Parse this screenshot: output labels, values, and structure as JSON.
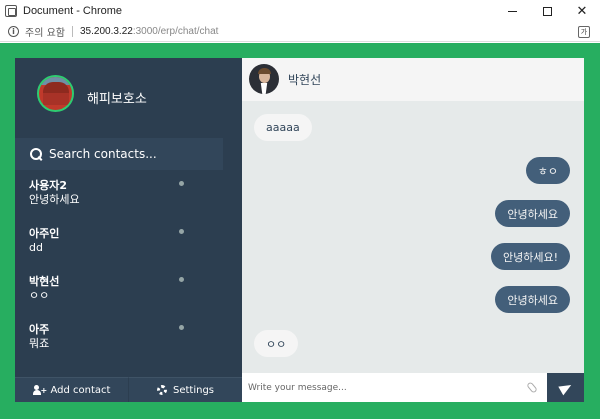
{
  "window": {
    "title": "Document - Chrome"
  },
  "address_bar": {
    "security_label": "주의 요함",
    "url_host": "35.200.3.22",
    "url_path": ":3000/erp/chat/chat"
  },
  "sidebar": {
    "profile_name": "해피보호소",
    "search": {
      "placeholder": "Search contacts..."
    },
    "contacts": [
      {
        "name": "사용자2",
        "preview": "안녕하세요"
      },
      {
        "name": "아주인",
        "preview": "dd"
      },
      {
        "name": "박현선",
        "preview": "ㅇㅇ"
      },
      {
        "name": "아주",
        "preview": "뭐죠"
      }
    ],
    "add_contact_label": "Add contact",
    "settings_label": "Settings"
  },
  "chat": {
    "contact_name": "박현선",
    "messages": [
      {
        "direction": "received",
        "text": "aaaaa"
      },
      {
        "direction": "sent",
        "text": "ㅎㅇ"
      },
      {
        "direction": "sent",
        "text": "안녕하세요"
      },
      {
        "direction": "sent",
        "text": "안녕하세요!"
      },
      {
        "direction": "sent",
        "text": "안녕하세요"
      },
      {
        "direction": "received",
        "text": "ㅇㅇ"
      }
    ],
    "composer": {
      "placeholder": "Write your message..."
    }
  },
  "colors": {
    "page_background": "#27ae60",
    "sidebar_background": "#2c3e50",
    "sent_bubble": "#435f7a",
    "received_bubble": "#f5f5f5",
    "chat_background": "#e6eaea"
  },
  "icons": [
    "info-icon",
    "translate-icon",
    "search-icon",
    "add-user-icon",
    "gear-icon",
    "paperclip-icon",
    "send-icon"
  ]
}
